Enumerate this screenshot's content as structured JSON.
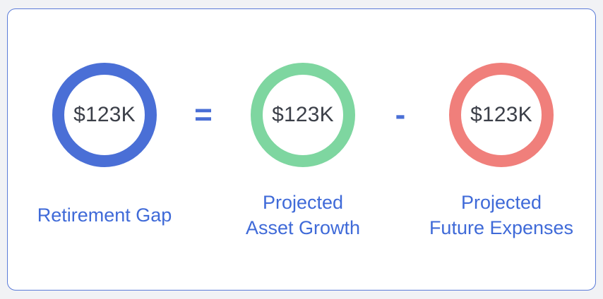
{
  "colors": {
    "gap": "#4a6fd6",
    "growth": "#7ed6a0",
    "expenses": "#f07f7b",
    "label": "#3f6ad8"
  },
  "gap": {
    "value": "$123K",
    "label": "Retirement Gap"
  },
  "growth": {
    "value": "$123K",
    "label_line1": "Projected",
    "label_line2": "Asset Growth"
  },
  "expenses": {
    "value": "$123K",
    "label_line1": "Projected",
    "label_line2": "Future Expenses"
  },
  "operators": {
    "equals": "=",
    "minus": "-"
  }
}
